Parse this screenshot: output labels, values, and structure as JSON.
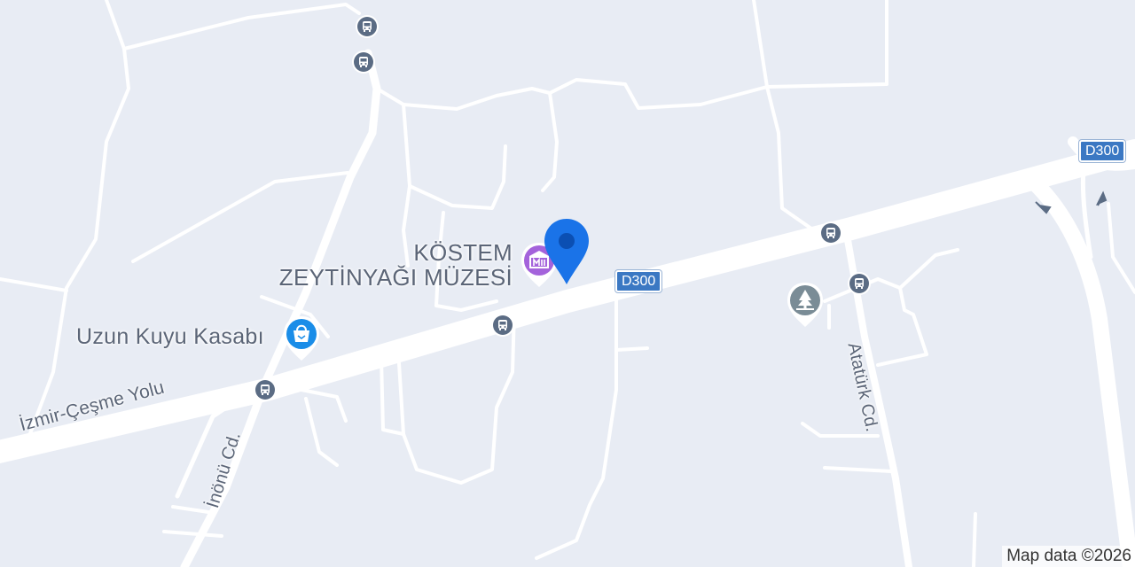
{
  "map": {
    "places": {
      "museum": {
        "line1": "KÖSTEM",
        "line2": "ZEYTİNYAĞI MÜZESİ",
        "icon": "museum-icon",
        "color": "#a463db"
      },
      "shop": {
        "name": "Uzun Kuyu Kasabı",
        "icon": "shopping-bag-icon",
        "color": "#1a8de8"
      },
      "park": {
        "icon": "tree-icon",
        "color": "#7a8c96"
      }
    },
    "roads": {
      "izmir_cesme": "İzmir-Çeşme Yolu",
      "inonu": "İnönü Cd.",
      "ataturk": "Atatürk Cd."
    },
    "shields": {
      "d300_center": "D300",
      "d300_right": "D300"
    },
    "bus_stop_icon": "bus-icon",
    "pin": {
      "icon": "location-pin-icon",
      "color": "#1a73e8"
    },
    "attribution": "Map data ©2026"
  }
}
